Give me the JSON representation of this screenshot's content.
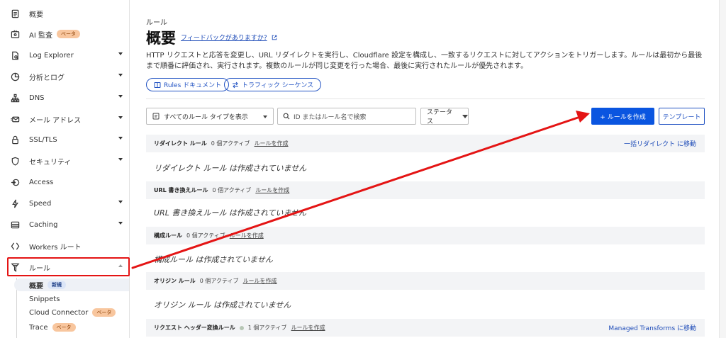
{
  "sidebar": {
    "items": [
      {
        "label": "概要",
        "icon": "document-icon",
        "chevron": false,
        "badge": ""
      },
      {
        "label": "AI 監査",
        "icon": "ai-audit-icon",
        "chevron": false,
        "badge": "ベータ"
      },
      {
        "label": "Log Explorer",
        "icon": "log-file-icon",
        "chevron": true,
        "badge": ""
      },
      {
        "label": "分析とログ",
        "icon": "pie-chart-icon",
        "chevron": true,
        "badge": ""
      },
      {
        "label": "DNS",
        "icon": "network-icon",
        "chevron": true,
        "badge": ""
      },
      {
        "label": "メール アドレス",
        "icon": "email-icon",
        "chevron": true,
        "badge": ""
      },
      {
        "label": "SSL/TLS",
        "icon": "lock-icon",
        "chevron": true,
        "badge": ""
      },
      {
        "label": "セキュリティ",
        "icon": "shield-icon",
        "chevron": true,
        "badge": ""
      },
      {
        "label": "Access",
        "icon": "access-icon",
        "chevron": false,
        "badge": ""
      },
      {
        "label": "Speed",
        "icon": "lightning-icon",
        "chevron": true,
        "badge": ""
      },
      {
        "label": "Caching",
        "icon": "caching-icon",
        "chevron": true,
        "badge": ""
      },
      {
        "label": "Workers ルート",
        "icon": "workers-icon",
        "chevron": false,
        "badge": ""
      },
      {
        "label": "ルール",
        "icon": "rules-icon",
        "chevron": true,
        "badge": ""
      }
    ],
    "sub_items": [
      {
        "label": "概要",
        "badge": "新規"
      },
      {
        "label": "Snippets",
        "badge": ""
      },
      {
        "label": "Cloud Connector",
        "badge": "ベータ"
      },
      {
        "label": "Trace",
        "badge": "ベータ"
      }
    ]
  },
  "main": {
    "breadcrumb": "ルール",
    "title": "概要",
    "feedback_link": "フィードバックがありますか?",
    "description": "HTTP リクエストと応答を変更し、URL リダイレクトを実行し、Cloudflare 設定を構成し、一致するリクエストに対してアクションをトリガーします。ルールは最初から最後まで順番に評価され、実行されます。複数のルールが同じ変更を行った場合、最後に実行されたルールが優先されます。",
    "pills": [
      "Rules ドキュメント",
      "トラフィック シーケンス"
    ],
    "filter_select": "すべてのルール タイプを表示",
    "search_placeholder": "ID またはルール名で検索",
    "status_filter": "ステータス",
    "create_button": "+ ルールを作成",
    "template_button": "テンプレート",
    "sections": [
      {
        "name": "リダイレクト ルール",
        "count": "0 個アクティブ",
        "create": "ルールを作成",
        "empty": "リダイレクト ルール は作成されていません",
        "link": "一括リダイレクト に移動"
      },
      {
        "name": "URL 書き換えルール",
        "count": "0 個アクティブ",
        "create": "ルールを作成",
        "empty": "URL 書き換えルール は作成されていません",
        "link": ""
      },
      {
        "name": "構成ルール",
        "count": "0 個アクティブ",
        "create": "ルールを作成",
        "empty": "構成ルール は作成されていません",
        "link": ""
      },
      {
        "name": "オリジン ルール",
        "count": "0 個アクティブ",
        "create": "ルールを作成",
        "empty": "オリジン ルール は作成されていません",
        "link": ""
      },
      {
        "name": "リクエスト ヘッダー変換ルール",
        "count": "1 個アクティブ",
        "create": "ルールを作成",
        "empty": "",
        "link": "Managed Transforms に移動"
      }
    ]
  },
  "annotation": {
    "color": "#e41414"
  },
  "colors": {
    "primary": "#0a55e0",
    "link": "#1d4bb8",
    "beta_badge": "#f8c69e",
    "new_badge": "#dbe5f7"
  }
}
